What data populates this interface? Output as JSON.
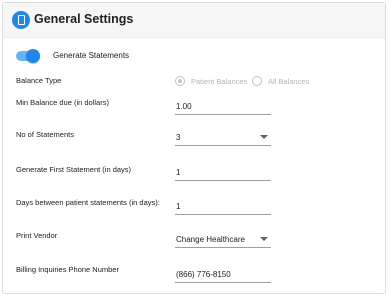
{
  "header": {
    "title": "General Settings",
    "icon": "document-icon",
    "accent_color": "#1e88e5"
  },
  "generate_statements": {
    "label": "Generate Statements",
    "enabled": true
  },
  "balance_type": {
    "label": "Balance Type",
    "options": [
      "Patient Balances",
      "All Balances"
    ],
    "selected": "Patient Balances",
    "disabled": true
  },
  "min_balance": {
    "label": "Min Balance due (in dollars)",
    "value": "1.00"
  },
  "num_statements": {
    "label": "No of Statements",
    "value": "3"
  },
  "first_statement": {
    "label": "Generate First Statement (in days)",
    "value": "1"
  },
  "days_between": {
    "label": "Days between patient statements (in days):",
    "value": "1"
  },
  "print_vendor": {
    "label": "Print Vendor",
    "value": "Change Healthcare"
  },
  "billing_phone": {
    "label": "Billing Inquiries Phone Number",
    "value": "(866) 776-8150"
  }
}
